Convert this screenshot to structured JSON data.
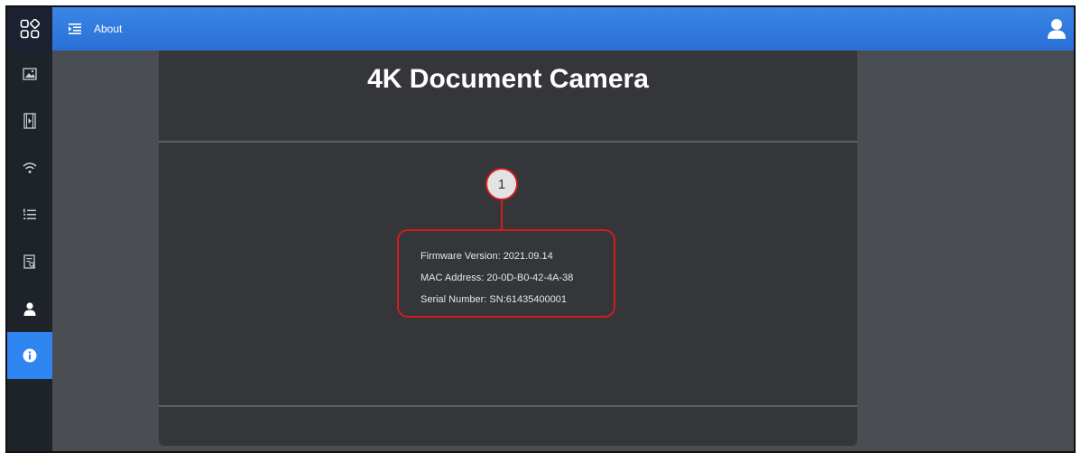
{
  "topbar": {
    "logo_icon": "grid-diamond-logo-icon",
    "menu_icon": "menu-collapse-icon",
    "title": "About",
    "user_icon": "user-icon",
    "colors": {
      "bar": "#2a6fd6",
      "logo_bg": "#1b2130"
    }
  },
  "sidebar": {
    "items": [
      {
        "icon": "image-icon",
        "active": false
      },
      {
        "icon": "video-icon",
        "active": false
      },
      {
        "icon": "wifi-icon",
        "active": false
      },
      {
        "icon": "list-icon",
        "active": false
      },
      {
        "icon": "log-icon",
        "active": false
      },
      {
        "icon": "user-icon",
        "active": false
      },
      {
        "icon": "info-icon",
        "active": true
      }
    ],
    "colors": {
      "bg": "#1e2229",
      "active": "#2f86f0"
    }
  },
  "main": {
    "title": "4K Document Camera",
    "info": {
      "firmware": "Firmware Version: 2021.09.14",
      "mac": "MAC Address: 20-0D-B0-42-4A-38",
      "serial": "Serial Number: SN:61435400001"
    },
    "callout": {
      "number": "1",
      "color": "#d21d1d"
    }
  }
}
